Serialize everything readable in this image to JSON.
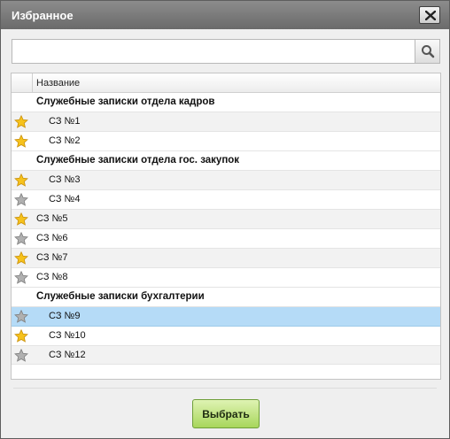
{
  "window": {
    "title": "Избранное",
    "accent": "#b5dbf7",
    "button_color": "#a7d65b"
  },
  "search": {
    "value": "",
    "placeholder": "",
    "icon": "search-icon"
  },
  "grid": {
    "column_name": "Название",
    "rows": [
      {
        "type": "group",
        "label": "Служебные записки отдела кадров"
      },
      {
        "type": "item",
        "label": "СЗ №1",
        "starred": true,
        "level": 1
      },
      {
        "type": "item",
        "label": "СЗ №2",
        "starred": true,
        "level": 1
      },
      {
        "type": "group",
        "label": "Служебные записки отдела гос. закупок"
      },
      {
        "type": "item",
        "label": "СЗ №3",
        "starred": true,
        "level": 1
      },
      {
        "type": "item",
        "label": "СЗ №4",
        "starred": false,
        "level": 1
      },
      {
        "type": "item",
        "label": "СЗ №5",
        "starred": true,
        "level": 0
      },
      {
        "type": "item",
        "label": "СЗ №6",
        "starred": false,
        "level": 0
      },
      {
        "type": "item",
        "label": "СЗ №7",
        "starred": true,
        "level": 0
      },
      {
        "type": "item",
        "label": "СЗ №8",
        "starred": false,
        "level": 0
      },
      {
        "type": "group",
        "label": "Служебные записки бухгалтерии"
      },
      {
        "type": "item",
        "label": "СЗ №9",
        "starred": false,
        "level": 1,
        "selected": true
      },
      {
        "type": "item",
        "label": "СЗ №10",
        "starred": true,
        "level": 1
      },
      {
        "type": "item",
        "label": "СЗ №12",
        "starred": false,
        "level": 1
      }
    ]
  },
  "footer": {
    "select_label": "Выбрать"
  }
}
